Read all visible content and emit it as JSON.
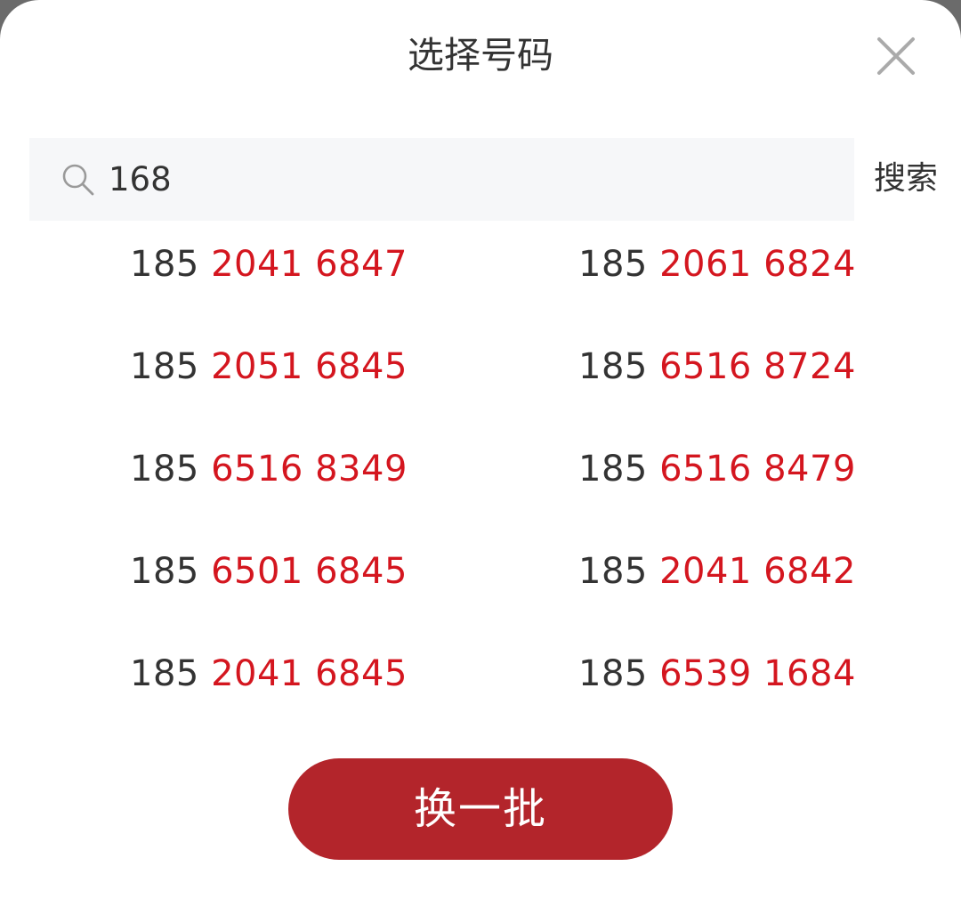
{
  "dialog": {
    "title": "选择号码",
    "close_icon": "close-icon"
  },
  "search": {
    "icon": "search-icon",
    "value": "168",
    "button_label": "搜索"
  },
  "numbers": [
    {
      "prefix": "185",
      "middle": "2041",
      "suffix": "6847"
    },
    {
      "prefix": "185",
      "middle": "2061",
      "suffix": "6824"
    },
    {
      "prefix": "185",
      "middle": "2051",
      "suffix": "6845"
    },
    {
      "prefix": "185",
      "middle": "6516",
      "suffix": "8724"
    },
    {
      "prefix": "185",
      "middle": "6516",
      "suffix": "8349"
    },
    {
      "prefix": "185",
      "middle": "6516",
      "suffix": "8479"
    },
    {
      "prefix": "185",
      "middle": "6501",
      "suffix": "6845"
    },
    {
      "prefix": "185",
      "middle": "2041",
      "suffix": "6842"
    },
    {
      "prefix": "185",
      "middle": "2041",
      "suffix": "6845"
    },
    {
      "prefix": "185",
      "middle": "6539",
      "suffix": "1684"
    }
  ],
  "refresh_button_label": "换一批",
  "colors": {
    "highlight": "#d4161f",
    "primary_button": "#b3252b",
    "text": "#333333",
    "search_bg": "#f6f7f9"
  }
}
